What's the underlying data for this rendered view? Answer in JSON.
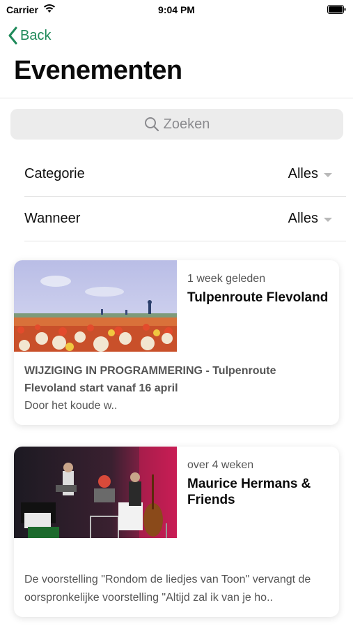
{
  "status_bar": {
    "carrier": "Carrier",
    "time": "9:04 PM"
  },
  "nav": {
    "back_label": "Back",
    "title": "Evenementen"
  },
  "search": {
    "placeholder": "Zoeken"
  },
  "filters": [
    {
      "label": "Categorie",
      "value": "Alles"
    },
    {
      "label": "Wanneer",
      "value": "Alles"
    }
  ],
  "events": [
    {
      "time": "1 week geleden",
      "title": "Tulpenroute Flevoland",
      "headline": "WIJZIGING IN PROGRAMMERING - Tulpenroute Flevoland start vanaf 16 april",
      "excerpt": "Door het koude w.."
    },
    {
      "time": "over 4 weken",
      "title": "Maurice Hermans & Friends",
      "headline": "",
      "excerpt": "De voorstelling \"Rondom de liedjes van Toon\" vervangt de oorspronkelijke voorstelling \"Altijd zal ik van je ho.."
    }
  ],
  "colors": {
    "accent": "#1f8a5a",
    "search_bg": "#ececec",
    "divider": "#e4e4e4"
  }
}
